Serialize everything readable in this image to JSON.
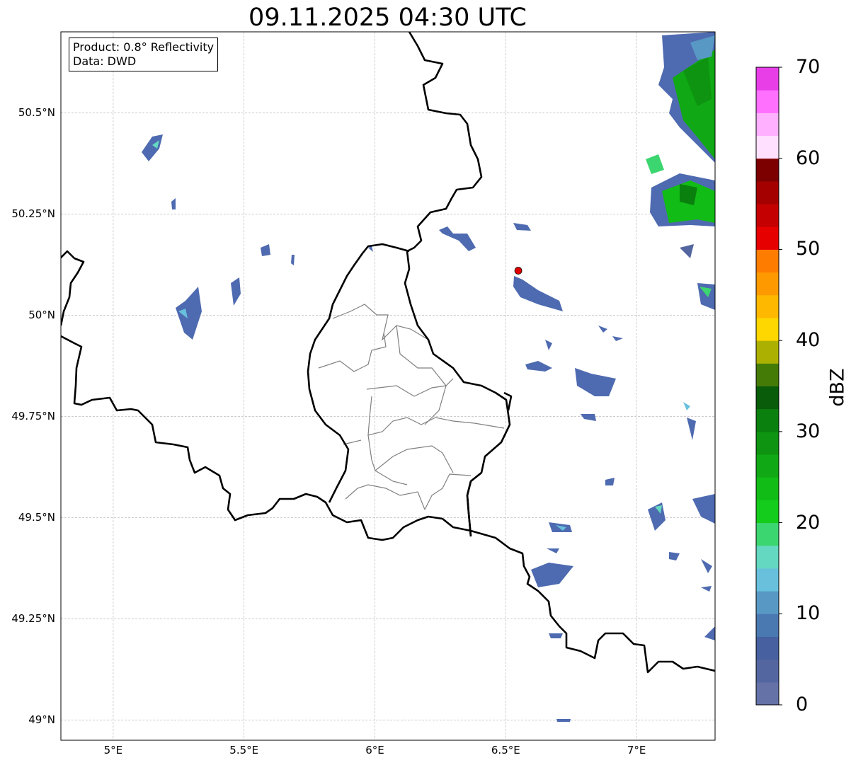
{
  "title": "09.11.2025 04:30 UTC",
  "info": {
    "product": "Product: 0.8° Reflectivity",
    "data_source": "Data: DWD"
  },
  "map_extent": {
    "lon": [
      4.8,
      7.3
    ],
    "lat": [
      48.95,
      50.7
    ]
  },
  "lat_ticks": [
    {
      "value": 50.5,
      "label": "50.5°N"
    },
    {
      "value": 50.25,
      "label": "50.25°N"
    },
    {
      "value": 50.0,
      "label": "50°N"
    },
    {
      "value": 49.75,
      "label": "49.75°N"
    },
    {
      "value": 49.5,
      "label": "49.5°N"
    },
    {
      "value": 49.25,
      "label": "49.25°N"
    },
    {
      "value": 49.0,
      "label": "49°N"
    }
  ],
  "lon_ticks": [
    {
      "value": 5.0,
      "label": "5°E"
    },
    {
      "value": 5.5,
      "label": "5.5°E"
    },
    {
      "value": 6.0,
      "label": "6°E"
    },
    {
      "value": 6.5,
      "label": "6.5°E"
    },
    {
      "value": 7.0,
      "label": "7°E"
    }
  ],
  "radar_site": {
    "lon": 6.548,
    "lat": 50.11,
    "color": "#e00000"
  },
  "colorbar": {
    "label": "dBZ",
    "min": 0,
    "max": 70,
    "step": 2.5,
    "ticks": [
      "0",
      "10",
      "20",
      "30",
      "40",
      "50",
      "60",
      "70"
    ],
    "colors": [
      "#6472a8",
      "#5466a0",
      "#4660a0",
      "#4a78b0",
      "#5898c4",
      "#68c0dc",
      "#64d8c0",
      "#3cd670",
      "#14cc1c",
      "#12bc16",
      "#10a814",
      "#0e9410",
      "#0a800e",
      "#085c0a",
      "#447a06",
      "#acb000",
      "#fed600",
      "#feb800",
      "#fe9a00",
      "#fe7c00",
      "#e60000",
      "#c40000",
      "#a40000",
      "#7c0000",
      "#ffe0ff",
      "#ffb0ff",
      "#ff70ff",
      "#e83ee8"
    ]
  },
  "colors": {
    "border": "#000000",
    "admin": "#808080",
    "grid": "#b0b0b0"
  }
}
